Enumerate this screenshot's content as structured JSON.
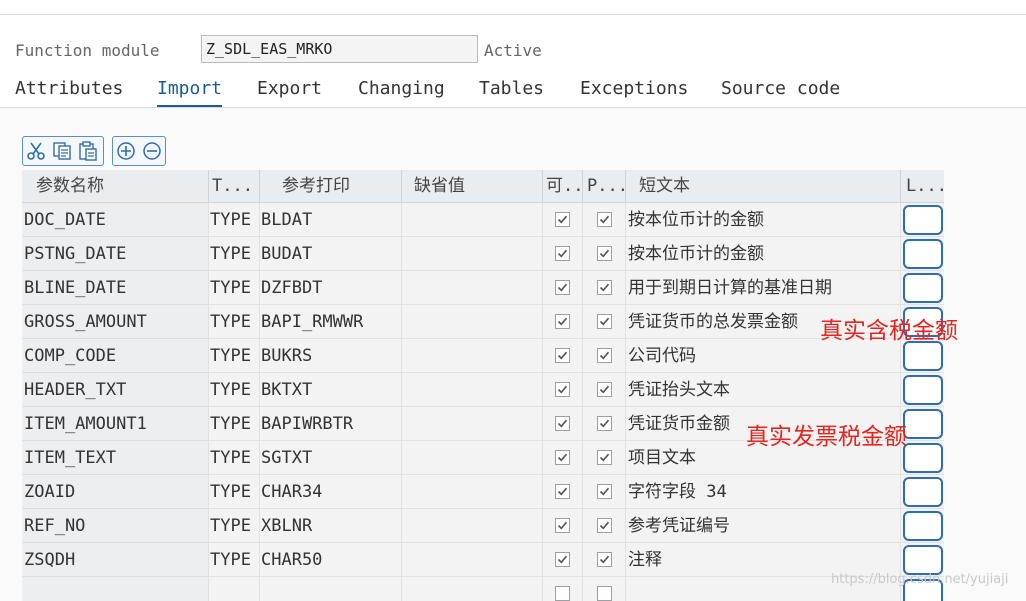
{
  "header": {
    "label": "Function module",
    "value": "Z_SDL_EAS_MRKO",
    "status": "Active"
  },
  "tabs": [
    {
      "label": "Attributes"
    },
    {
      "label": "Import"
    },
    {
      "label": "Export"
    },
    {
      "label": "Changing"
    },
    {
      "label": "Tables"
    },
    {
      "label": "Exceptions"
    },
    {
      "label": "Source code"
    }
  ],
  "active_tab": "Import",
  "toolbar": {
    "icons": [
      "cut-icon",
      "copy-icon",
      "paste-icon",
      "insert-row-icon",
      "delete-row-icon"
    ]
  },
  "table": {
    "columns": [
      "参数名称",
      "T...",
      "参考打印",
      "缺省值",
      "可..",
      "P...",
      "短文本",
      "L..."
    ],
    "rows": [
      {
        "name": "DOC_DATE",
        "typing": "TYPE",
        "ref": "BLDAT",
        "default": "",
        "optional": true,
        "pass_value": true,
        "text": "按本位币计的金额"
      },
      {
        "name": "PSTNG_DATE",
        "typing": "TYPE",
        "ref": "BUDAT",
        "default": "",
        "optional": true,
        "pass_value": true,
        "text": "按本位币计的金额"
      },
      {
        "name": "BLINE_DATE",
        "typing": "TYPE",
        "ref": "DZFBDT",
        "default": "",
        "optional": true,
        "pass_value": true,
        "text": "用于到期日计算的基准日期"
      },
      {
        "name": "GROSS_AMOUNT",
        "typing": "TYPE",
        "ref": "BAPI_RMWWR",
        "default": "",
        "optional": true,
        "pass_value": true,
        "text": "凭证货币的总发票金额"
      },
      {
        "name": "COMP_CODE",
        "typing": "TYPE",
        "ref": "BUKRS",
        "default": "",
        "optional": true,
        "pass_value": true,
        "text": "公司代码"
      },
      {
        "name": "HEADER_TXT",
        "typing": "TYPE",
        "ref": "BKTXT",
        "default": "",
        "optional": true,
        "pass_value": true,
        "text": "凭证抬头文本"
      },
      {
        "name": "ITEM_AMOUNT1",
        "typing": "TYPE",
        "ref": "BAPIWRBTR",
        "default": "",
        "optional": true,
        "pass_value": true,
        "text": "凭证货币金额"
      },
      {
        "name": "ITEM_TEXT",
        "typing": "TYPE",
        "ref": "SGTXT",
        "default": "",
        "optional": true,
        "pass_value": true,
        "text": "项目文本"
      },
      {
        "name": "ZOAID",
        "typing": "TYPE",
        "ref": "CHAR34",
        "default": "",
        "optional": true,
        "pass_value": true,
        "text": "字符字段 34"
      },
      {
        "name": "REF_NO",
        "typing": "TYPE",
        "ref": "XBLNR",
        "default": "",
        "optional": true,
        "pass_value": true,
        "text": "参考凭证编号"
      },
      {
        "name": "ZSQDH",
        "typing": "TYPE",
        "ref": "CHAR50",
        "default": "",
        "optional": true,
        "pass_value": true,
        "text": "注释"
      },
      {
        "name": "",
        "typing": "",
        "ref": "",
        "default": "",
        "optional": false,
        "pass_value": false,
        "text": ""
      }
    ]
  },
  "annotations": [
    "真实含税金额",
    "真实发票税金额"
  ],
  "watermark": "https://blog.csdn.net/yujiaji",
  "colors": {
    "accent": "#1a5a9c",
    "annotation": "#e8241f",
    "link_box": "#2f6db0"
  }
}
